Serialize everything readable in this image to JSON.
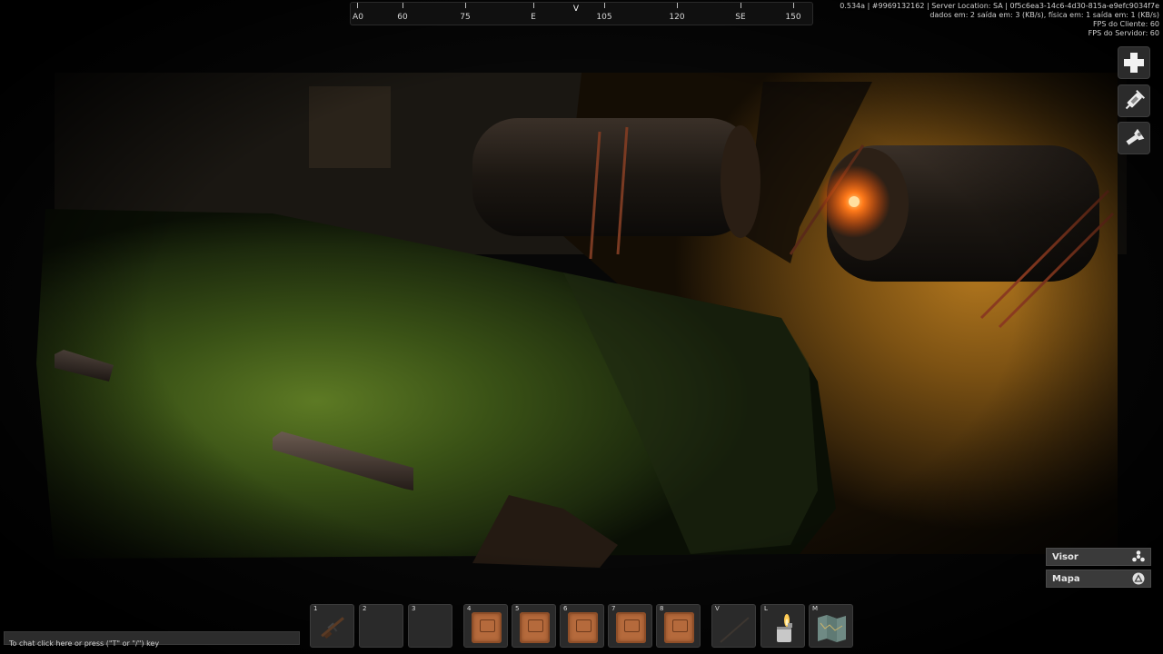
{
  "compass": {
    "labels": [
      "A0",
      "60",
      "75",
      "E",
      "105",
      "120",
      "SE",
      "150"
    ],
    "marker": "V"
  },
  "debug": {
    "line1": "0.534a | #9969132162 | Server Location: SA | 0f5c6ea3-14c6-4d30-815a-e9efc9034f7e",
    "line2": "dados em: 2 saída em: 3 (KB/s), física em: 1 saída em: 1 (KB/s)",
    "line3": "FPS do Cliente: 60",
    "line4": "FPS do Servidor: 60"
  },
  "side_buttons": [
    "health-plus-icon",
    "syringe-icon",
    "flashlight-icon"
  ],
  "toggles": {
    "visor": {
      "label": "Visor",
      "icon": "fan-icon"
    },
    "mapa": {
      "label": "Mapa",
      "icon": "triangle-icon"
    }
  },
  "chat": {
    "placeholder": "To chat click here or press (\"T\" or \"/\") key"
  },
  "hotbar": [
    {
      "key": "1",
      "item": "rifle-icon"
    },
    {
      "key": "2",
      "item": ""
    },
    {
      "key": "3",
      "item": ""
    },
    {
      "key": "4",
      "item": "package-icon"
    },
    {
      "key": "5",
      "item": "package-icon"
    },
    {
      "key": "6",
      "item": "package-icon"
    },
    {
      "key": "7",
      "item": "package-icon"
    },
    {
      "key": "8",
      "item": "package-icon"
    },
    {
      "key": "V",
      "item": "stick-icon"
    },
    {
      "key": "L",
      "item": "lighter-icon"
    },
    {
      "key": "M",
      "item": "map-icon"
    }
  ],
  "colors": {
    "hud_bg": "#2a2a2a",
    "lamp_glow": "#ff7a1a",
    "ground_green": "#3f5a1a",
    "ground_orange": "#8a5a16"
  }
}
